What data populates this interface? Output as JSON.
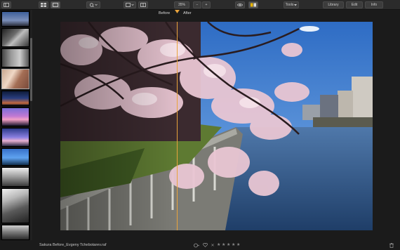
{
  "toolbar": {
    "zoom_value": "35%",
    "zoom_minus": "−",
    "zoom_plus": "+",
    "tools_label": "Tools",
    "library_label": "Library",
    "edit_label": "Edit",
    "info_label": "Info"
  },
  "compare": {
    "before_label": "Before",
    "after_label": "After"
  },
  "status": {
    "filename": "Sakura Before_Evgeny Tchebotarev.raf",
    "reject": "✕",
    "stars": [
      "★",
      "★",
      "★",
      "★",
      "★"
    ]
  },
  "colors": {
    "accent_divider": "#e8a33c",
    "flag_active": "#e6b400",
    "sky": "#2f6fc2",
    "water": "#2c4f80"
  },
  "icons": {
    "toolbar": [
      "grid-icon",
      "single-view-icon",
      "eye-search-icon",
      "crop-icon",
      "compare-icon",
      "zoom-out-icon",
      "zoom-in-icon",
      "eye-icon",
      "flag-icon",
      "tools-dropdown-icon"
    ],
    "status": [
      "circle-tag-icon",
      "heart-icon",
      "reject-icon",
      "star-icon",
      "trash-icon"
    ]
  }
}
